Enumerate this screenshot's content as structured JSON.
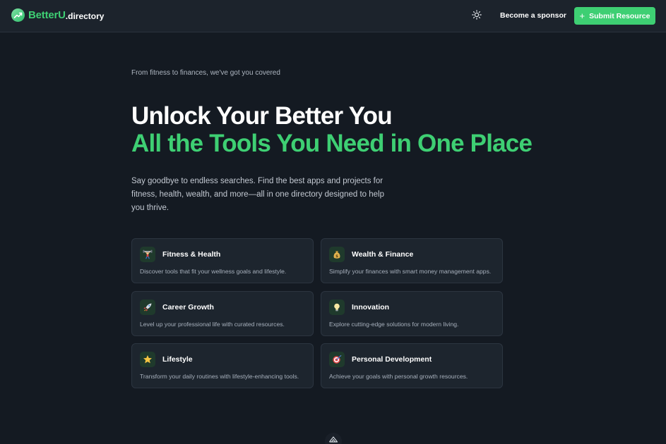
{
  "header": {
    "logo_name": "BetterU",
    "logo_tld": ".directory",
    "sponsor_label": "Become a sponsor",
    "submit_label": "Submit Resource"
  },
  "hero": {
    "tagline": "From fitness to finances, we've got you covered",
    "headline_1": "Unlock Your Better You",
    "headline_2": "All the Tools You Need in One Place",
    "description": "Say goodbye to endless searches. Find the best apps and projects for fitness, health, wealth, and more—all in one directory designed to help you thrive."
  },
  "categories": [
    {
      "icon": "weightlifter-icon",
      "title": "Fitness & Health",
      "description": "Discover tools that fit your wellness goals and lifestyle."
    },
    {
      "icon": "money-bag-icon",
      "title": "Wealth & Finance",
      "description": "Simplify your finances with smart money management apps."
    },
    {
      "icon": "rocket-icon",
      "title": "Career Growth",
      "description": "Level up your professional life with curated resources."
    },
    {
      "icon": "lightbulb-icon",
      "title": "Innovation",
      "description": "Explore cutting-edge solutions for modern living."
    },
    {
      "icon": "star-icon",
      "title": "Lifestyle",
      "description": "Transform your daily routines with lifestyle-enhancing tools."
    },
    {
      "icon": "target-icon",
      "title": "Personal Development",
      "description": "Achieve your goals with personal growth resources."
    }
  ],
  "colors": {
    "background": "#141a22",
    "header": "#1c232c",
    "accent": "#3ecf73",
    "card": "#1d252e"
  }
}
